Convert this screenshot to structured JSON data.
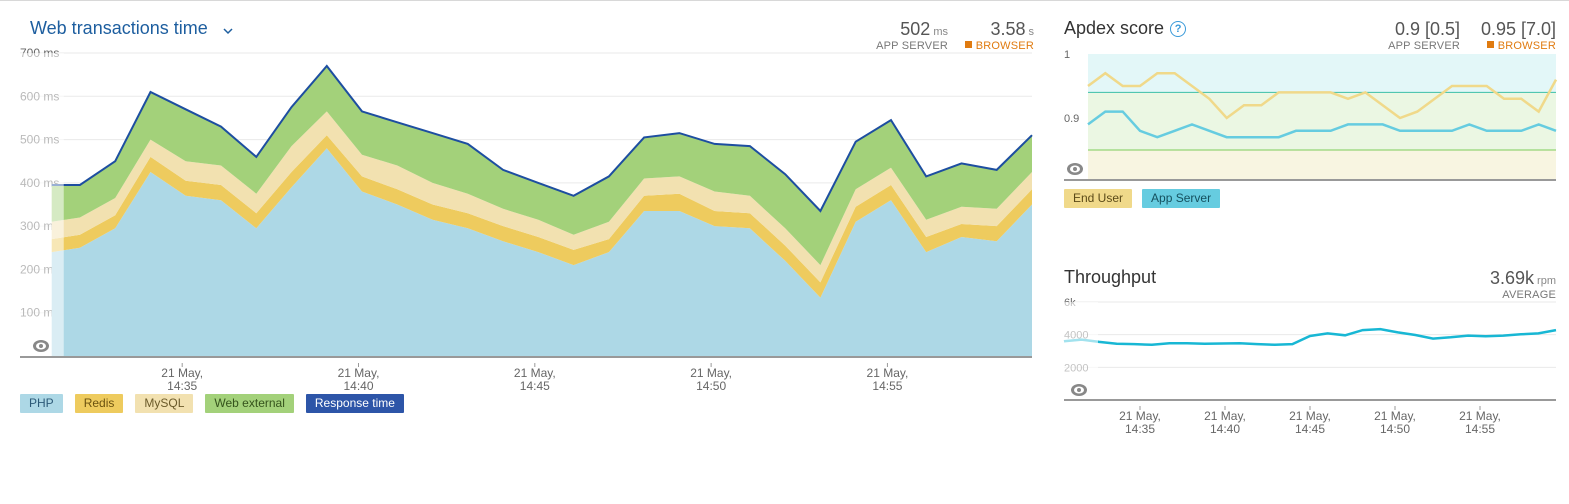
{
  "colors": {
    "php": "#add8e6",
    "redis": "#eecb5e",
    "mysql": "#f2e1b0",
    "web_external": "#a3d17a",
    "response_time": "#1d4ea0",
    "browser": "#e07b10",
    "end_user": "#f0d98a",
    "app_server": "#66cce0",
    "throughput": "#18b7d4"
  },
  "x_ticks": [
    {
      "date": "21 May,",
      "time": "14:35",
      "minute": 35
    },
    {
      "date": "21 May,",
      "time": "14:40",
      "minute": 40
    },
    {
      "date": "21 May,",
      "time": "14:45",
      "minute": 45
    },
    {
      "date": "21 May,",
      "time": "14:50",
      "minute": 50
    },
    {
      "date": "21 May,",
      "time": "14:55",
      "minute": 55
    }
  ],
  "web": {
    "title": "Web transactions time",
    "app_server_value": "502",
    "app_server_unit": "ms",
    "app_server_label": "APP SERVER",
    "browser_value": "3.58",
    "browser_unit": "s",
    "browser_label": "BROWSER",
    "legend": [
      "PHP",
      "Redis",
      "MySQL",
      "Web external",
      "Response time"
    ]
  },
  "apdex": {
    "title": "Apdex score",
    "app_server_value": "0.9 [0.5]",
    "app_server_label": "APP SERVER",
    "browser_value": "0.95 [7.0]",
    "browser_label": "BROWSER",
    "legend": [
      "End User",
      "App Server"
    ]
  },
  "throughput": {
    "title": "Throughput",
    "value": "3.69k",
    "unit": "rpm",
    "sub": "AVERAGE"
  },
  "chart_data": [
    {
      "type": "area",
      "title": "Web transactions time",
      "y_ticks": [
        "700 ms",
        "600 ms",
        "500 ms",
        "400 ms",
        "300 ms",
        "200 ms",
        "100 ms"
      ],
      "ylim": [
        0,
        700
      ],
      "x_minutes": [
        31.3,
        32.1,
        33.1,
        34.1,
        35.1,
        36.1,
        37.1,
        38.1,
        39.1,
        40.1,
        41.1,
        42.1,
        43.1,
        44.1,
        45.1,
        46.1,
        47.1,
        48.1,
        49.1,
        50.1,
        51.1,
        52.1,
        53.1,
        54.1,
        55.1,
        56.1,
        57.1,
        58.1,
        59.1
      ],
      "series": [
        {
          "name": "PHP",
          "values": [
            240,
            250,
            295,
            425,
            370,
            360,
            295,
            390,
            480,
            380,
            350,
            315,
            295,
            265,
            240,
            210,
            240,
            335,
            335,
            300,
            295,
            220,
            135,
            310,
            360,
            240,
            275,
            265,
            350
          ]
        },
        {
          "name": "Redis",
          "values": [
            30,
            30,
            30,
            35,
            35,
            35,
            35,
            35,
            30,
            35,
            35,
            35,
            35,
            35,
            35,
            35,
            30,
            35,
            40,
            35,
            35,
            35,
            35,
            35,
            35,
            35,
            30,
            35,
            35
          ]
        },
        {
          "name": "MySQL",
          "values": [
            40,
            40,
            40,
            40,
            45,
            45,
            45,
            60,
            55,
            50,
            55,
            50,
            45,
            40,
            40,
            35,
            40,
            40,
            40,
            45,
            40,
            40,
            40,
            40,
            40,
            40,
            40,
            40,
            40
          ]
        },
        {
          "name": "Web external",
          "values": [
            85,
            75,
            85,
            110,
            120,
            90,
            85,
            90,
            105,
            100,
            100,
            115,
            115,
            90,
            85,
            90,
            105,
            95,
            100,
            110,
            115,
            125,
            125,
            110,
            110,
            100,
            100,
            90,
            85
          ]
        }
      ],
      "response_time": [
        395,
        395,
        450,
        610,
        570,
        530,
        460,
        575,
        670,
        565,
        540,
        515,
        490,
        430,
        400,
        370,
        415,
        505,
        515,
        490,
        485,
        420,
        335,
        495,
        545,
        415,
        445,
        430,
        510
      ]
    },
    {
      "type": "line",
      "title": "Apdex score",
      "y_ticks": [
        "1",
        "0.9"
      ],
      "series": [
        {
          "name": "End User",
          "values": [
            0.95,
            0.97,
            0.95,
            0.95,
            0.97,
            0.97,
            0.95,
            0.93,
            0.9,
            0.92,
            0.92,
            0.94,
            0.94,
            0.94,
            0.94,
            0.93,
            0.94,
            0.92,
            0.9,
            0.91,
            0.93,
            0.95,
            0.95,
            0.95,
            0.93,
            0.93,
            0.91,
            0.96
          ]
        },
        {
          "name": "App Server",
          "values": [
            0.89,
            0.91,
            0.91,
            0.88,
            0.87,
            0.88,
            0.89,
            0.88,
            0.87,
            0.87,
            0.87,
            0.87,
            0.88,
            0.88,
            0.88,
            0.89,
            0.89,
            0.89,
            0.88,
            0.88,
            0.88,
            0.88,
            0.89,
            0.88,
            0.88,
            0.88,
            0.89,
            0.88
          ]
        }
      ]
    },
    {
      "type": "line",
      "title": "Throughput",
      "y_ticks": [
        "6k",
        "4000",
        "2000"
      ],
      "ylim": [
        0,
        6000
      ],
      "series": [
        {
          "name": "Throughput",
          "values": [
            3600,
            3700,
            3560,
            3440,
            3420,
            3380,
            3480,
            3480,
            3440,
            3460,
            3480,
            3420,
            3380,
            3420,
            3920,
            4080,
            3960,
            4280,
            4340,
            4140,
            3980,
            3760,
            3840,
            3940,
            3900,
            3940,
            4020,
            4080,
            4280
          ]
        }
      ]
    }
  ]
}
